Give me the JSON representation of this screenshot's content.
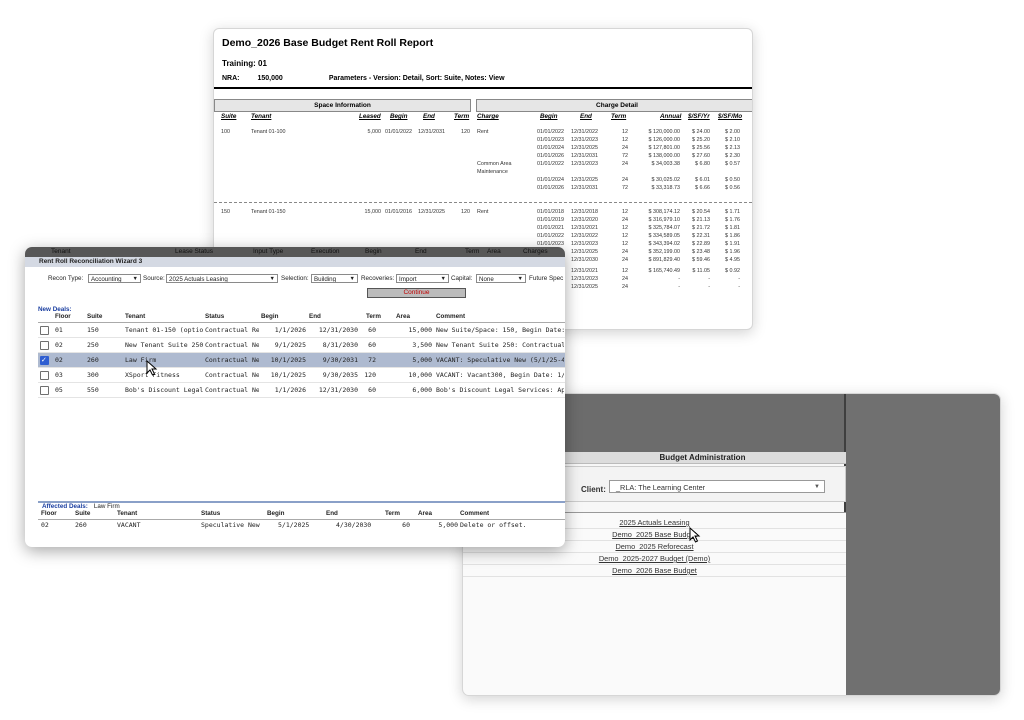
{
  "report": {
    "title": "Demo_2026 Base Budget Rent Roll Report",
    "training": "Training: 01",
    "nra_label": "NRA:",
    "nra_value": "150,000",
    "parameters": "Parameters - Version: Detail, Sort: Suite, Notes: View",
    "space_section": "Space Information",
    "charge_section": "Charge Detail",
    "space_headers": [
      "Suite",
      "Tenant",
      "Leased",
      "Begin",
      "End",
      "Term"
    ],
    "charge_headers": [
      "Charge",
      "Begin",
      "End",
      "Term",
      "Annual",
      "$/SF/Yr",
      "$/SF/Mo"
    ],
    "suites": [
      {
        "suite": "100",
        "tenant": "Tenant 01-100",
        "leased": "5,000",
        "begin": "01/01/2022",
        "end": "12/31/2031",
        "term": "120",
        "charges": [
          {
            "charge": "Rent",
            "begin": "01/01/2022",
            "end": "12/31/2022",
            "term": "12",
            "annual": "$ 120,000.00",
            "yr": "$ 24.00",
            "mo": "$ 2.00"
          },
          {
            "charge": "",
            "begin": "01/01/2023",
            "end": "12/31/2023",
            "term": "12",
            "annual": "$ 126,000.00",
            "yr": "$ 25.20",
            "mo": "$ 2.10"
          },
          {
            "charge": "",
            "begin": "01/01/2024",
            "end": "12/31/2025",
            "term": "24",
            "annual": "$ 127,801.00",
            "yr": "$ 25.56",
            "mo": "$ 2.13"
          },
          {
            "charge": "",
            "begin": "01/01/2026",
            "end": "12/31/2031",
            "term": "72",
            "annual": "$ 138,000.00",
            "yr": "$ 27.60",
            "mo": "$ 2.30"
          },
          {
            "charge": "Common Area",
            "charge2": "Maintenance",
            "begin": "01/01/2022",
            "end": "12/31/2023",
            "term": "24",
            "annual": "$ 34,003.38",
            "yr": "$ 6.80",
            "mo": "$ 0.57"
          },
          {
            "charge": "",
            "begin": "01/01/2024",
            "end": "12/31/2025",
            "term": "24",
            "annual": "$ 30,025.02",
            "yr": "$ 6.01",
            "mo": "$ 0.50"
          },
          {
            "charge": "",
            "begin": "01/01/2026",
            "end": "12/31/2031",
            "term": "72",
            "annual": "$ 33,318.73",
            "yr": "$ 6.66",
            "mo": "$ 0.56"
          }
        ]
      },
      {
        "suite": "150",
        "tenant": "Tenant 01-150",
        "leased": "15,000",
        "begin": "01/01/2016",
        "end": "12/31/2025",
        "term": "120",
        "charges": [
          {
            "charge": "Rent",
            "begin": "01/01/2018",
            "end": "12/31/2018",
            "term": "12",
            "annual": "$ 308,174.12",
            "yr": "$ 20.54",
            "mo": "$ 1.71"
          },
          {
            "charge": "",
            "begin": "01/01/2019",
            "end": "12/31/2020",
            "term": "24",
            "annual": "$ 316,979.10",
            "yr": "$ 21.13",
            "mo": "$ 1.76"
          },
          {
            "charge": "",
            "begin": "01/01/2021",
            "end": "12/31/2021",
            "term": "12",
            "annual": "$ 325,784.07",
            "yr": "$ 21.72",
            "mo": "$ 1.81"
          },
          {
            "charge": "",
            "begin": "01/01/2022",
            "end": "12/31/2022",
            "term": "12",
            "annual": "$ 334,589.05",
            "yr": "$ 22.31",
            "mo": "$ 1.86"
          },
          {
            "charge": "",
            "begin": "01/01/2023",
            "end": "12/31/2023",
            "term": "12",
            "annual": "$ 343,394.02",
            "yr": "$ 22.89",
            "mo": "$ 1.91"
          },
          {
            "charge": "",
            "begin": "",
            "end": "12/31/2025",
            "term": "24",
            "annual": "$ 352,199.00",
            "yr": "$ 23.48",
            "mo": "$ 1.96"
          },
          {
            "charge": "",
            "begin": "",
            "end": "12/31/2030",
            "term": "24",
            "annual": "$ 891,829.40",
            "yr": "$ 59.46",
            "mo": "$ 4.95"
          },
          {
            "charge": "",
            "begin": "",
            "end": "12/31/2021",
            "term": "12",
            "annual": "$ 165,740.49",
            "yr": "$ 11.05",
            "mo": "$ 0.92"
          },
          {
            "charge": "",
            "begin": "",
            "end": "12/31/2023",
            "term": "24",
            "annual": "-",
            "yr": "-",
            "mo": "-"
          },
          {
            "charge": "",
            "begin": "",
            "end": "12/31/2025",
            "term": "24",
            "annual": "-",
            "yr": "-",
            "mo": "-"
          }
        ]
      }
    ]
  },
  "wizard": {
    "ghost_headers": [
      "Tenant",
      "Lease Status",
      "Input Type",
      "Execution",
      "Begin",
      "End",
      "Term",
      "Area",
      "Charges"
    ],
    "title": "Rent Roll Reconciliation Wizard 3",
    "recon_type_label": "Recon Type:",
    "recon_type_value": "Accounting",
    "source_label": "Source:",
    "source_value": "2025 Actuals Leasing",
    "selection_label": "Selection:",
    "selection_value": "Building",
    "recoveries_label": "Recoveries:",
    "recoveries_value": "Import",
    "capital_label": "Capital:",
    "capital_value": "None",
    "future_label": "Future Spec",
    "continue_label": "Continue",
    "new_deals_label": "New Deals:",
    "columns": [
      "Floor",
      "Suite",
      "Tenant",
      "Status",
      "Begin",
      "End",
      "Term",
      "Area",
      "Comment"
    ],
    "rows": [
      {
        "checked": false,
        "floor": "01",
        "suite": "150",
        "tenant": "Tenant 01-150 (option)",
        "status": "Contractual Ren",
        "begin": "1/1/2026",
        "end": "12/31/2030",
        "term": "60",
        "area": "15,000",
        "comment": "New Suite/Space: 150, Begin Date: 1/"
      },
      {
        "checked": false,
        "floor": "02",
        "suite": "250",
        "tenant": "New Tenant Suite 250",
        "status": "Contractual New",
        "begin": "9/1/2025",
        "end": "8/31/2030",
        "term": "60",
        "area": "3,500",
        "comment": "New Tenant Suite 250: Contractual Ne"
      },
      {
        "checked": true,
        "floor": "02",
        "suite": "260",
        "tenant": "Law Firm",
        "status": "Contractual New",
        "begin": "10/1/2025",
        "end": "9/30/2031",
        "term": "72",
        "area": "5,000",
        "comment": "VACANT: Speculative New (5/1/25-4/3"
      },
      {
        "checked": false,
        "floor": "03",
        "suite": "300",
        "tenant": "XSport Fitness",
        "status": "Contractual New",
        "begin": "10/1/2025",
        "end": "9/30/2035",
        "term": "120",
        "area": "10,000",
        "comment": "VACANT: Vacant300, Begin Date: 1/1/"
      },
      {
        "checked": false,
        "floor": "05",
        "suite": "550",
        "tenant": "Bob's Discount Legal S",
        "status": "Contractual New",
        "begin": "1/1/2026",
        "end": "12/31/2030",
        "term": "60",
        "area": "6,000",
        "comment": "Bob's Discount Legal Services: Approv"
      }
    ],
    "affected_label": "Affected Deals:",
    "affected_value": "Law Firm",
    "affected_columns": [
      "Floor",
      "Suite",
      "Tenant",
      "Status",
      "Begin",
      "End",
      "Term",
      "Area",
      "Comment"
    ],
    "affected_row": {
      "floor": "02",
      "suite": "260",
      "tenant": "VACANT",
      "status": "Speculative New",
      "begin": "5/1/2025",
      "end": "4/30/2030",
      "term": "60",
      "area": "5,000",
      "comment": "Delete or offset."
    }
  },
  "budget": {
    "title": "Budget Administration",
    "client_label": "Client:",
    "client_value": "_RLA: The Learning Center",
    "items": [
      "2025 Actuals Leasing",
      "Demo_2025 Base Budget",
      "Demo_2025 Reforecast",
      "Demo_2025-2027 Budget (Demo)",
      "Demo_2026 Base Budget"
    ]
  },
  "icons": {
    "select_arrow": "chevron-down-icon",
    "cursor": "pointer-cursor-icon"
  }
}
